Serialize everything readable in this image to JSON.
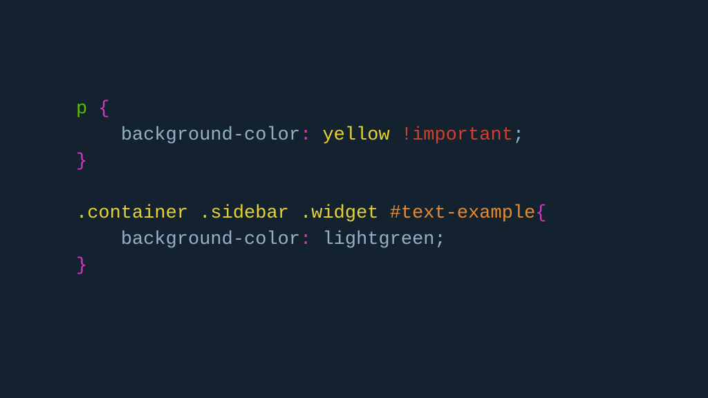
{
  "code": {
    "rule1": {
      "selector": "p",
      "brace_open": " {",
      "indent": "    ",
      "property": "background-color",
      "colon": ":",
      "space": " ",
      "value": "yellow",
      "important": " !important",
      "semicolon": ";",
      "brace_close": "}"
    },
    "rule2": {
      "class1": ".container",
      "sp1": " ",
      "class2": ".sidebar",
      "sp2": " ",
      "class3": ".widget",
      "sp3": " ",
      "id": "#text-example",
      "brace_open": "{",
      "indent": "    ",
      "property": "background-color",
      "colon": ":",
      "space": " ",
      "value": "lightgreen",
      "semicolon": ";",
      "brace_close": "}"
    }
  }
}
